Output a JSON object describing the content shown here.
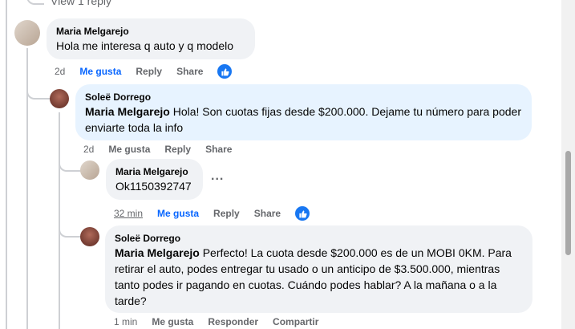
{
  "top": {
    "view_replies": "View 1 reply"
  },
  "comments": [
    {
      "author": "Maria Melgarejo",
      "text": "Hola me interesa q auto y q modelo",
      "time": "2d",
      "like": "Me gusta",
      "reply": "Reply",
      "share": "Share",
      "avatar_color": "#c7b8a8"
    },
    {
      "author": "Soleë Dorrego",
      "mention": "Maria Melgarejo",
      "text": " Hola! Son cuotas fijas desde $200.000. Dejame tu número para poder enviarte toda la info",
      "time": "2d",
      "like": "Me gusta",
      "reply": "Reply",
      "share": "Share",
      "avatar_color": "#7a3b30"
    },
    {
      "author": "Maria Melgarejo",
      "text": "Ok1150392747",
      "time": "32 min",
      "like": "Me gusta",
      "reply": "Reply",
      "share": "Share",
      "more": "...",
      "avatar_color": "#c7b8a8"
    },
    {
      "author": "Soleë Dorrego",
      "mention": "Maria Melgarejo",
      "text": " Perfecto! La cuota desde $200.000 es de un MOBI 0KM. Para retirar el auto, podes entregar tu usado o un anticipo de $3.500.000, mientras tanto podes ir pagando en cuotas. Cuándo podes hablar? A la mañana o a la tarde?",
      "time": "1 min",
      "like": "Me gusta",
      "reply": "Responder",
      "share": "Compartir",
      "avatar_color": "#7a3b30"
    }
  ],
  "colors": {
    "accent": "#0866ff",
    "like_badge": "#1877f2",
    "thread_line": "#ced0d4"
  }
}
